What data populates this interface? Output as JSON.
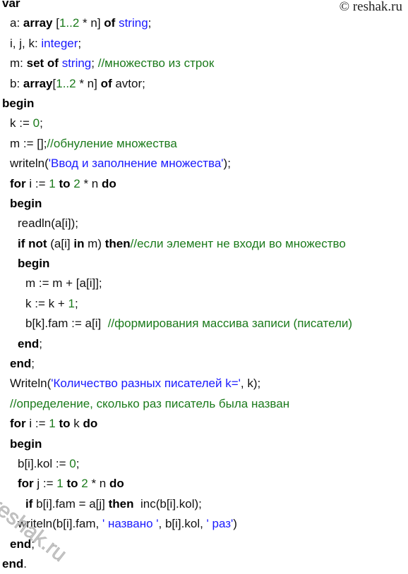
{
  "watermark": "© reshak.ru",
  "watermark_diagonal": "reshak.ru",
  "colors": {
    "keyword": "#000000",
    "string": "#1a1aff",
    "number": "#1b7a1b",
    "comment": "#1b7a1b"
  },
  "lines": [
    {
      "indent": 0,
      "tokens": [
        {
          "t": "var",
          "c": "kw"
        }
      ]
    },
    {
      "indent": 1,
      "tokens": [
        {
          "t": "a: ",
          "c": "p"
        },
        {
          "t": "array",
          "c": "kw"
        },
        {
          "t": " [",
          "c": "p"
        },
        {
          "t": "1..2",
          "c": "num"
        },
        {
          "t": " * n] ",
          "c": "p"
        },
        {
          "t": "of",
          "c": "kw"
        },
        {
          "t": " ",
          "c": "p"
        },
        {
          "t": "string",
          "c": "str"
        },
        {
          "t": ";",
          "c": "p"
        }
      ]
    },
    {
      "indent": 1,
      "tokens": [
        {
          "t": "i, j, k: ",
          "c": "p"
        },
        {
          "t": "integer",
          "c": "str"
        },
        {
          "t": ";",
          "c": "p"
        }
      ]
    },
    {
      "indent": 1,
      "tokens": [
        {
          "t": "m: ",
          "c": "p"
        },
        {
          "t": "set of",
          "c": "kw"
        },
        {
          "t": " ",
          "c": "p"
        },
        {
          "t": "string",
          "c": "str"
        },
        {
          "t": "; ",
          "c": "p"
        },
        {
          "t": "//множество из строк",
          "c": "com"
        }
      ]
    },
    {
      "indent": 1,
      "tokens": [
        {
          "t": "b: ",
          "c": "p"
        },
        {
          "t": "array",
          "c": "kw"
        },
        {
          "t": "[",
          "c": "p"
        },
        {
          "t": "1..2",
          "c": "num"
        },
        {
          "t": " * n] ",
          "c": "p"
        },
        {
          "t": "of",
          "c": "kw"
        },
        {
          "t": " avtor;",
          "c": "p"
        }
      ]
    },
    {
      "indent": 0,
      "tokens": [
        {
          "t": "begin",
          "c": "kw"
        }
      ]
    },
    {
      "indent": 1,
      "tokens": [
        {
          "t": "k := ",
          "c": "p"
        },
        {
          "t": "0",
          "c": "num"
        },
        {
          "t": ";",
          "c": "p"
        }
      ]
    },
    {
      "indent": 1,
      "tokens": [
        {
          "t": "m := [];",
          "c": "p"
        },
        {
          "t": "//обнуление множества",
          "c": "com"
        }
      ]
    },
    {
      "indent": 1,
      "tokens": [
        {
          "t": "writeln(",
          "c": "p"
        },
        {
          "t": "'Ввод и заполнение множества'",
          "c": "str"
        },
        {
          "t": ");",
          "c": "p"
        }
      ]
    },
    {
      "indent": 1,
      "tokens": [
        {
          "t": "for",
          "c": "kw"
        },
        {
          "t": " i := ",
          "c": "p"
        },
        {
          "t": "1",
          "c": "num"
        },
        {
          "t": " ",
          "c": "p"
        },
        {
          "t": "to",
          "c": "kw"
        },
        {
          "t": " ",
          "c": "p"
        },
        {
          "t": "2",
          "c": "num"
        },
        {
          "t": " * n ",
          "c": "p"
        },
        {
          "t": "do",
          "c": "kw"
        }
      ]
    },
    {
      "indent": 1,
      "tokens": [
        {
          "t": "begin",
          "c": "kw"
        }
      ]
    },
    {
      "indent": 2,
      "tokens": [
        {
          "t": "readln(a[i]);",
          "c": "p"
        }
      ]
    },
    {
      "indent": 2,
      "tokens": [
        {
          "t": "if not",
          "c": "kw"
        },
        {
          "t": " (a[i] ",
          "c": "p"
        },
        {
          "t": "in",
          "c": "kw"
        },
        {
          "t": " m) ",
          "c": "p"
        },
        {
          "t": "then",
          "c": "kw"
        },
        {
          "t": "//если элемент не входи во множество",
          "c": "com"
        }
      ]
    },
    {
      "indent": 2,
      "tokens": [
        {
          "t": "begin",
          "c": "kw"
        }
      ]
    },
    {
      "indent": 3,
      "tokens": [
        {
          "t": "m := m + [a[i]];",
          "c": "p"
        }
      ]
    },
    {
      "indent": 3,
      "tokens": [
        {
          "t": "k := k + ",
          "c": "p"
        },
        {
          "t": "1",
          "c": "num"
        },
        {
          "t": ";",
          "c": "p"
        }
      ]
    },
    {
      "indent": 3,
      "tokens": [
        {
          "t": "b[k].fam := a[i]  ",
          "c": "p"
        },
        {
          "t": "//формирования массива записи (писатели)",
          "c": "com"
        }
      ]
    },
    {
      "indent": 2,
      "tokens": [
        {
          "t": "end",
          "c": "kw"
        },
        {
          "t": ";",
          "c": "p"
        }
      ]
    },
    {
      "indent": 1,
      "tokens": [
        {
          "t": "end",
          "c": "kw"
        },
        {
          "t": ";",
          "c": "p"
        }
      ]
    },
    {
      "indent": 1,
      "tokens": [
        {
          "t": "Writeln(",
          "c": "p"
        },
        {
          "t": "'Количество разных писателей k='",
          "c": "str"
        },
        {
          "t": ", k);",
          "c": "p"
        }
      ]
    },
    {
      "indent": 1,
      "tokens": [
        {
          "t": "//определение, сколько раз писатель была назван",
          "c": "com"
        }
      ]
    },
    {
      "indent": 1,
      "tokens": [
        {
          "t": "for",
          "c": "kw"
        },
        {
          "t": " i := ",
          "c": "p"
        },
        {
          "t": "1",
          "c": "num"
        },
        {
          "t": " ",
          "c": "p"
        },
        {
          "t": "to",
          "c": "kw"
        },
        {
          "t": " k ",
          "c": "p"
        },
        {
          "t": "do",
          "c": "kw"
        }
      ]
    },
    {
      "indent": 1,
      "tokens": [
        {
          "t": "begin",
          "c": "kw"
        }
      ]
    },
    {
      "indent": 2,
      "tokens": [
        {
          "t": "b[i].kol := ",
          "c": "p"
        },
        {
          "t": "0",
          "c": "num"
        },
        {
          "t": ";",
          "c": "p"
        }
      ]
    },
    {
      "indent": 2,
      "tokens": [
        {
          "t": "for",
          "c": "kw"
        },
        {
          "t": " j := ",
          "c": "p"
        },
        {
          "t": "1",
          "c": "num"
        },
        {
          "t": " ",
          "c": "p"
        },
        {
          "t": "to",
          "c": "kw"
        },
        {
          "t": " ",
          "c": "p"
        },
        {
          "t": "2",
          "c": "num"
        },
        {
          "t": " * n ",
          "c": "p"
        },
        {
          "t": "do",
          "c": "kw"
        }
      ]
    },
    {
      "indent": 3,
      "tokens": [
        {
          "t": "if",
          "c": "kw"
        },
        {
          "t": " b[i].fam = a[j] ",
          "c": "p"
        },
        {
          "t": "then",
          "c": "kw"
        },
        {
          "t": "  inc(b[i].kol);",
          "c": "p"
        }
      ]
    },
    {
      "indent": 2,
      "tokens": [
        {
          "t": "writeln(b[i].fam, ",
          "c": "p"
        },
        {
          "t": "' названо '",
          "c": "str"
        },
        {
          "t": ", b[i].kol, ",
          "c": "p"
        },
        {
          "t": "' раз'",
          "c": "str"
        },
        {
          "t": ")",
          "c": "p"
        }
      ]
    },
    {
      "indent": 1,
      "tokens": [
        {
          "t": "end",
          "c": "kw"
        },
        {
          "t": ";",
          "c": "p"
        }
      ]
    },
    {
      "indent": 0,
      "tokens": [
        {
          "t": "end",
          "c": "kw"
        },
        {
          "t": ".",
          "c": "p"
        }
      ]
    }
  ]
}
